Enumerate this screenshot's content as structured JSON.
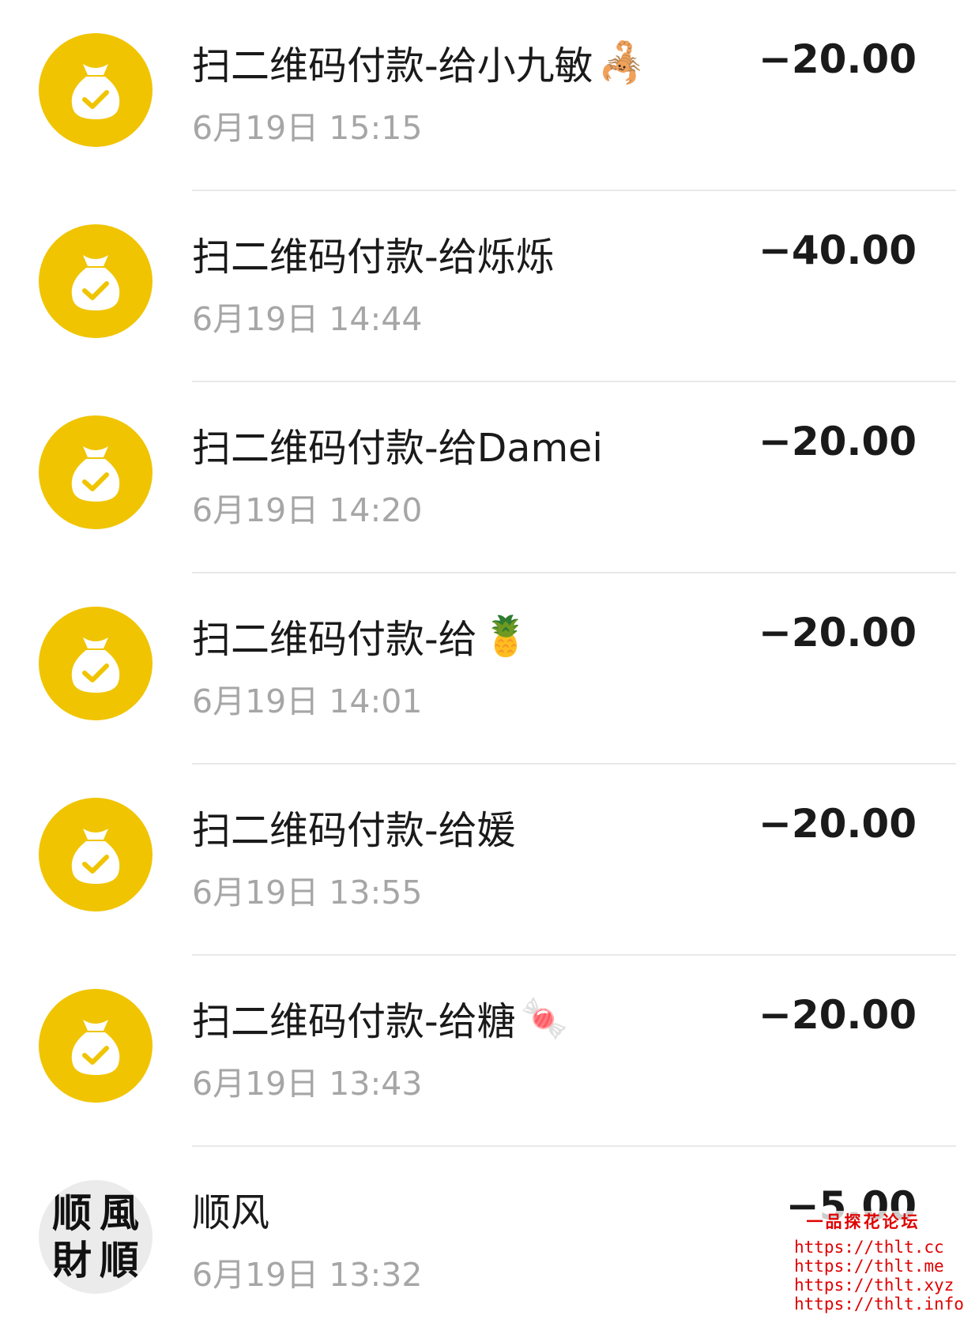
{
  "transactions": [
    {
      "title": "扫二维码付款-给小九敏",
      "emoji": "🦂",
      "emoji_name": "scorpion-emoji",
      "time": "6月19日 15:15",
      "amount": "−20.00",
      "avatar": "money-bag"
    },
    {
      "title": "扫二维码付款-给烁烁",
      "emoji": "",
      "emoji_name": "",
      "time": "6月19日 14:44",
      "amount": "−40.00",
      "avatar": "money-bag"
    },
    {
      "title": "扫二维码付款-给Damei",
      "emoji": "",
      "emoji_name": "",
      "time": "6月19日 14:20",
      "amount": "−20.00",
      "avatar": "money-bag"
    },
    {
      "title": "扫二维码付款-给",
      "emoji": "🍍",
      "emoji_name": "pineapple-emoji",
      "time": "6月19日 14:01",
      "amount": "−20.00",
      "avatar": "money-bag"
    },
    {
      "title": "扫二维码付款-给媛",
      "emoji": "",
      "emoji_name": "",
      "time": "6月19日 13:55",
      "amount": "−20.00",
      "avatar": "money-bag"
    },
    {
      "title": "扫二维码付款-给糖",
      "emoji": "🍬",
      "emoji_name": "candy-emoji",
      "time": "6月19日 13:43",
      "amount": "−20.00",
      "avatar": "money-bag"
    },
    {
      "title": "顺风",
      "emoji": "",
      "emoji_name": "",
      "time": "6月19日 13:32",
      "amount": "−5.00",
      "avatar": "calligraphy",
      "avatar_text": [
        "顺",
        "風",
        "財",
        "順"
      ]
    }
  ],
  "watermark": {
    "title": "一品探花论坛",
    "links": [
      "https://thlt.cc",
      "https://thlt.me",
      "https://thlt.xyz",
      "https://thlt.info"
    ]
  },
  "colors": {
    "icon_bg": "#f0c400",
    "amount_text": "#1a1a1a",
    "time_text": "#a6a6a6",
    "watermark_text": "#e00000"
  }
}
